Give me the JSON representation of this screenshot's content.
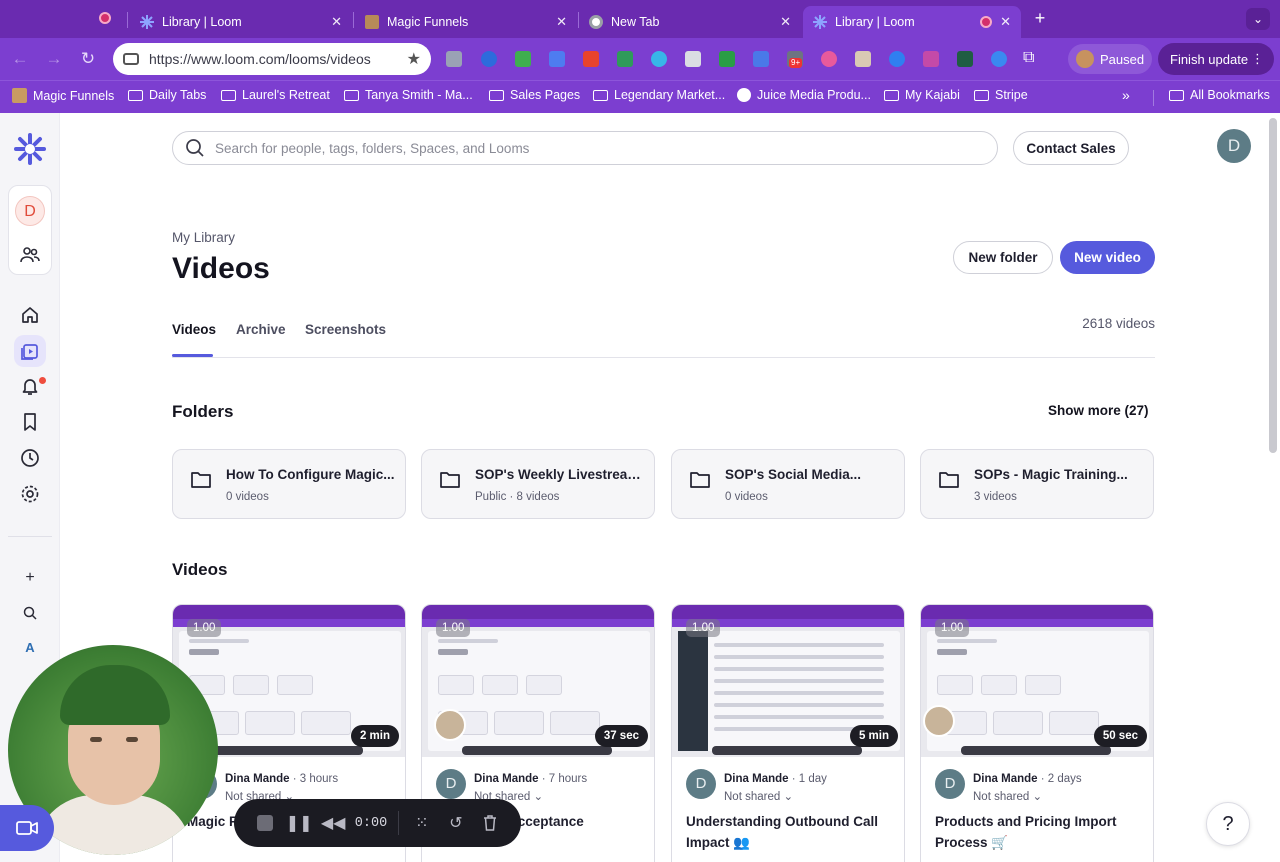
{
  "browser": {
    "tabs": [
      {
        "title": "Library | Loom",
        "active": false
      },
      {
        "title": "Magic Funnels",
        "active": false
      },
      {
        "title": "New Tab",
        "active": false
      },
      {
        "title": "Library | Loom",
        "active": true
      }
    ],
    "url": "https://www.loom.com/looms/videos",
    "profile_status": "Paused",
    "update_label": "Finish update",
    "extension_badge": "9+",
    "bookmarks": [
      {
        "label": "Magic Funnels",
        "icon": "image"
      },
      {
        "label": "Daily Tabs",
        "icon": "folder"
      },
      {
        "label": "Laurel's Retreat",
        "icon": "folder"
      },
      {
        "label": "Tanya Smith - Ma...",
        "icon": "folder"
      },
      {
        "label": "Sales Pages",
        "icon": "folder"
      },
      {
        "label": "Legendary Market...",
        "icon": "folder"
      },
      {
        "label": "Juice Media Produ...",
        "icon": "globe"
      },
      {
        "label": "My Kajabi",
        "icon": "folder"
      },
      {
        "label": "Stripe",
        "icon": "folder"
      }
    ],
    "all_bookmarks": "All Bookmarks"
  },
  "app": {
    "workspace_initial": "D",
    "search_placeholder": "Search for people, tags, folders, Spaces, and Looms",
    "contact_sales": "Contact Sales",
    "user_initial": "D",
    "breadcrumb": "My Library",
    "page_title": "Videos",
    "new_folder": "New folder",
    "new_video": "New video",
    "tabs": [
      "Videos",
      "Archive",
      "Screenshots"
    ],
    "video_count": "2618 videos",
    "folders_title": "Folders",
    "show_more": "Show more (27)",
    "folders": [
      {
        "name": "How To Configure Magic...",
        "meta": "0 videos"
      },
      {
        "name": "SOP's Weekly Livestreams",
        "meta": "Public · 8 videos"
      },
      {
        "name": "SOP's Social Media...",
        "meta": "0 videos"
      },
      {
        "name": "SOPs - Magic Training...",
        "meta": "3 videos"
      }
    ],
    "videos_title": "Videos",
    "videos": [
      {
        "speed": "1.00",
        "duration": "2 min",
        "author": "Dina Mande",
        "time": "· 3 hours",
        "shared": "Not shared",
        "title": "Magic Funnels Tutorial"
      },
      {
        "speed": "1.00",
        "duration": "37 sec",
        "author": "Dina Mande",
        "time": "· 7 hours",
        "shared": "Not shared",
        "title": "Acceptance"
      },
      {
        "speed": "1.00",
        "duration": "5 min",
        "author": "Dina Mande",
        "time": "· 1 day",
        "shared": "Not shared",
        "title": "Understanding Outbound Call Impact 👥"
      },
      {
        "speed": "1.00",
        "duration": "50 sec",
        "author": "Dina Mande",
        "time": "· 2 days",
        "shared": "Not shared",
        "title": "Products and Pricing Import Process 🛒"
      }
    ]
  },
  "recorder": {
    "timer": "0:00"
  },
  "help_label": "?"
}
